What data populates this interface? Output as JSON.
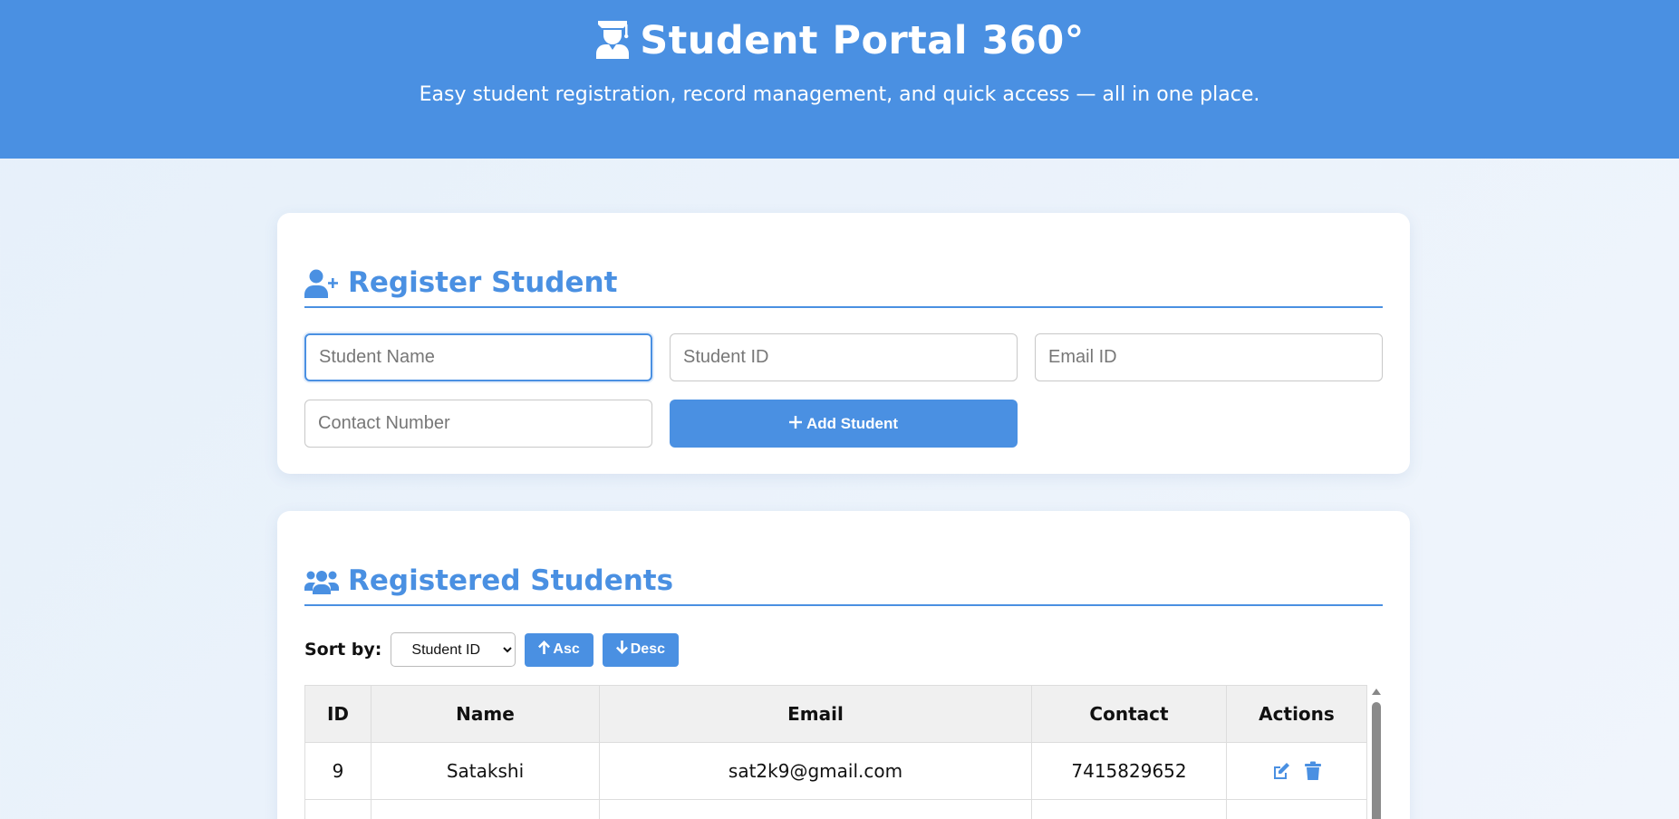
{
  "header": {
    "title": "Student Portal 360°",
    "subtitle": "Easy student registration, record management, and quick access — all in one place.",
    "icon": "graduate-icon"
  },
  "colors": {
    "accent": "#4a90e2",
    "header_bg": "#4a90e2",
    "card_bg": "#ffffff",
    "page_bg": "#e6f0fa"
  },
  "register": {
    "title": "Register Student",
    "icon": "user-plus-icon",
    "fields": {
      "name_placeholder": "Student Name",
      "id_placeholder": "Student ID",
      "email_placeholder": "Email ID",
      "contact_placeholder": "Contact Number",
      "name_value": "",
      "id_value": "",
      "email_value": "",
      "contact_value": ""
    },
    "add_button_label": "Add Student",
    "add_button_icon": "plus-icon"
  },
  "list": {
    "title": "Registered Students",
    "icon": "users-icon",
    "sort_label": "Sort by:",
    "sort_selected": "Student ID",
    "asc_label": "Asc",
    "desc_label": "Desc",
    "columns": [
      "ID",
      "Name",
      "Email",
      "Contact",
      "Actions"
    ],
    "rows": [
      {
        "id": "9",
        "name": "Satakshi",
        "email": "sat2k9@gmail.com",
        "contact": "7415829652"
      }
    ],
    "row_actions": [
      "edit-icon",
      "trash-icon"
    ]
  }
}
